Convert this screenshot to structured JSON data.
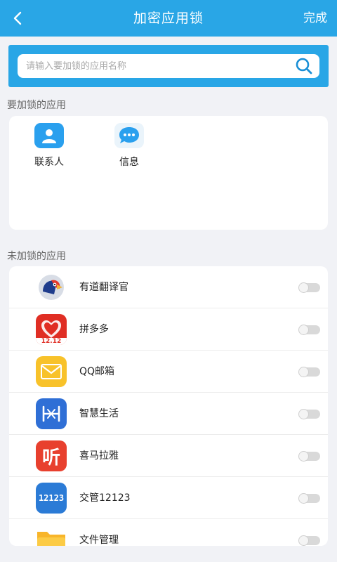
{
  "header": {
    "title": "加密应用锁",
    "done_label": "完成"
  },
  "search": {
    "placeholder": "请输入要加锁的应用名称"
  },
  "locked_section": {
    "title": "要加锁的应用",
    "apps": [
      {
        "label": "联系人",
        "icon": "contacts-icon",
        "color": "#2aa0ee"
      },
      {
        "label": "信息",
        "icon": "messages-icon",
        "color": "#2aa0ee"
      }
    ]
  },
  "unlocked_section": {
    "title": "未加锁的应用",
    "apps": [
      {
        "label": "有道翻译官",
        "icon": "youdao-translator-icon",
        "enabled": false
      },
      {
        "label": "拼多多",
        "icon": "pinduoduo-icon",
        "badge": "12.12",
        "enabled": false
      },
      {
        "label": "QQ邮箱",
        "icon": "qq-mail-icon",
        "enabled": false
      },
      {
        "label": "智慧生活",
        "icon": "smart-life-icon",
        "enabled": false
      },
      {
        "label": "喜马拉雅",
        "icon": "ximalaya-icon",
        "glyph": "听",
        "enabled": false
      },
      {
        "label": "交管12123",
        "icon": "traffic-12123-icon",
        "glyph": "12123",
        "enabled": false
      },
      {
        "label": "文件管理",
        "icon": "file-manager-icon",
        "enabled": false
      }
    ]
  },
  "colors": {
    "accent": "#29a6e6",
    "background": "#f1f2f6"
  }
}
